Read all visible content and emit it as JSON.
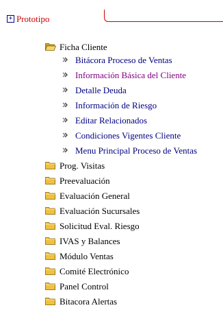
{
  "header": {
    "expand_symbol": "+",
    "title": "Prototipo"
  },
  "tree": {
    "open_folder": {
      "label": "Ficha Cliente",
      "children": [
        {
          "label": "Bitácora Proceso de Ventas",
          "visited": false
        },
        {
          "label": "Información Básica del Cliente",
          "visited": true
        },
        {
          "label": "Detalle Deuda",
          "visited": false
        },
        {
          "label": "Información de Riesgo",
          "visited": false
        },
        {
          "label": "Editar Relacionados",
          "visited": false
        },
        {
          "label": "Condiciones Vigentes Cliente",
          "visited": false
        },
        {
          "label": "Menu Principal Proceso de Ventas",
          "visited": false
        }
      ]
    },
    "closed_folders": [
      {
        "label": "Prog. Visitas"
      },
      {
        "label": "Preevaluación"
      },
      {
        "label": "Evaluación General"
      },
      {
        "label": "Evaluación Sucursales"
      },
      {
        "label": "Solicitud Eval. Riesgo"
      },
      {
        "label": "IVAS y Balances"
      },
      {
        "label": "Módulo Ventas"
      },
      {
        "label": "Comité Electrónico"
      },
      {
        "label": "Panel Control"
      },
      {
        "label": "Bitacora Alertas"
      }
    ]
  },
  "colors": {
    "title": "#cc0000",
    "link": "#000080",
    "visited_link": "#800080",
    "folder_fill": "#f0c040",
    "folder_stroke": "#806000"
  },
  "icons": {
    "open_folder": "folder-open-icon",
    "closed_folder": "folder-closed-icon",
    "bullet": "bullet-arrow-icon",
    "expand": "plus-box-icon"
  }
}
